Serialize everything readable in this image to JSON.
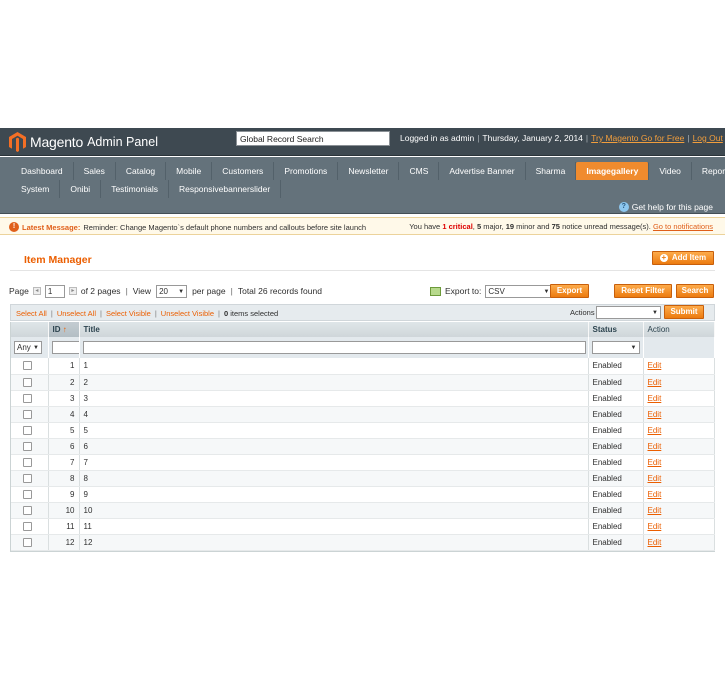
{
  "header": {
    "brand": "Magento",
    "panel_label": "Admin Panel",
    "search_value": "Global Record Search",
    "logged_in_text": "Logged in as admin",
    "date_text": "Thursday, January 2, 2014",
    "try_link": "Try Magento Go for Free",
    "logout_link": "Log Out"
  },
  "nav": {
    "row1": [
      "Dashboard",
      "Sales",
      "Catalog",
      "Mobile",
      "Customers",
      "Promotions",
      "Newsletter",
      "CMS",
      "Advertise Banner",
      "Sharma",
      "Imagegallery",
      "Video",
      "Reports"
    ],
    "row2": [
      "System",
      "Onibi",
      "Testimonials",
      "Responsivebannerslider"
    ],
    "active": "Imagegallery",
    "help_text": "Get help for this page"
  },
  "message": {
    "label": "Latest Message:",
    "text": "Reminder: Change Magento`s default phone numbers and callouts before site launch",
    "summary_prefix": "You have",
    "critical_count": "1",
    "critical_label": "critical",
    "major_count": "5",
    "major_label": "major",
    "minor_count": "19",
    "minor_label": "minor and",
    "notice_count": "75",
    "notice_label": "notice unread message(s).",
    "link": "Go to notifications"
  },
  "page": {
    "title": "Item Manager",
    "add_button": "Add Item"
  },
  "pager": {
    "page_label": "Page",
    "page_value": "1",
    "of_pages": "of 2 pages",
    "view_label": "View",
    "per_page_value": "20",
    "per_page_label": "per page",
    "records": "Total 26 records found",
    "export_label": "Export to:",
    "export_format": "CSV",
    "export_button": "Export",
    "reset_button": "Reset Filter",
    "search_button": "Search"
  },
  "massaction": {
    "select_all": "Select All",
    "unselect_all": "Unselect All",
    "select_visible": "Select Visible",
    "unselect_visible": "Unselect Visible",
    "selected_count": "0",
    "selected_label": "items selected",
    "actions_label": "Actions",
    "submit_button": "Submit"
  },
  "table": {
    "columns": {
      "id": "ID",
      "title": "Title",
      "status": "Status",
      "action": "Action"
    },
    "filter_any": "Any",
    "rows": [
      {
        "id": "1",
        "title": "1",
        "status": "Enabled",
        "action": "Edit"
      },
      {
        "id": "2",
        "title": "2",
        "status": "Enabled",
        "action": "Edit"
      },
      {
        "id": "3",
        "title": "3",
        "status": "Enabled",
        "action": "Edit"
      },
      {
        "id": "4",
        "title": "4",
        "status": "Enabled",
        "action": "Edit"
      },
      {
        "id": "5",
        "title": "5",
        "status": "Enabled",
        "action": "Edit"
      },
      {
        "id": "6",
        "title": "6",
        "status": "Enabled",
        "action": "Edit"
      },
      {
        "id": "7",
        "title": "7",
        "status": "Enabled",
        "action": "Edit"
      },
      {
        "id": "8",
        "title": "8",
        "status": "Enabled",
        "action": "Edit"
      },
      {
        "id": "9",
        "title": "9",
        "status": "Enabled",
        "action": "Edit"
      },
      {
        "id": "10",
        "title": "10",
        "status": "Enabled",
        "action": "Edit"
      },
      {
        "id": "11",
        "title": "11",
        "status": "Enabled",
        "action": "Edit"
      },
      {
        "id": "12",
        "title": "12",
        "status": "Enabled",
        "action": "Edit"
      }
    ]
  },
  "colors": {
    "accent": "#eb5e00",
    "header_bg": "#3e4951",
    "nav_bg": "#64727b",
    "active_tab": "#f08b2e"
  }
}
